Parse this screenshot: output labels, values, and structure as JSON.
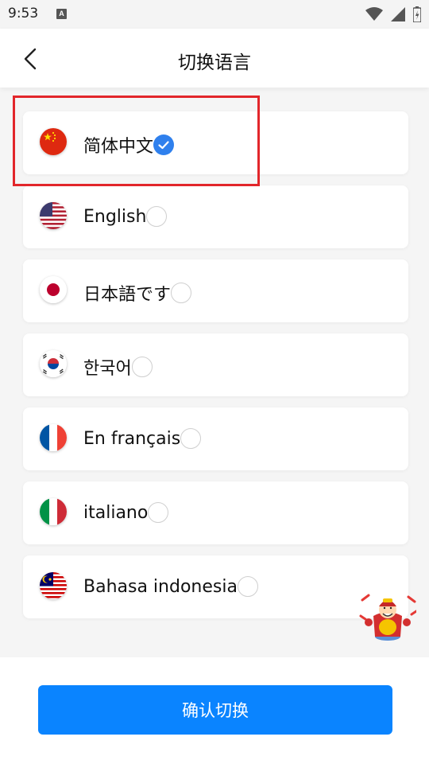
{
  "status_bar": {
    "time": "9:53",
    "notification_icon": "A"
  },
  "header": {
    "title": "切换语言",
    "back_icon": "chevron-left-icon"
  },
  "languages": [
    {
      "label": "简体中文",
      "flag": "china-flag-icon",
      "selected": true
    },
    {
      "label": "English",
      "flag": "usa-flag-icon",
      "selected": false
    },
    {
      "label": "日本語です",
      "flag": "japan-flag-icon",
      "selected": false
    },
    {
      "label": "한국어",
      "flag": "korea-flag-icon",
      "selected": false
    },
    {
      "label": "En français",
      "flag": "france-flag-icon",
      "selected": false
    },
    {
      "label": "italiano",
      "flag": "italy-flag-icon",
      "selected": false
    },
    {
      "label": "Bahasa indonesia",
      "flag": "malaysia-flag-icon",
      "selected": false
    }
  ],
  "footer": {
    "confirm_label": "确认切换"
  },
  "colors": {
    "accent": "#0a84ff",
    "check": "#2f80ed",
    "highlight": "#e2262b"
  }
}
